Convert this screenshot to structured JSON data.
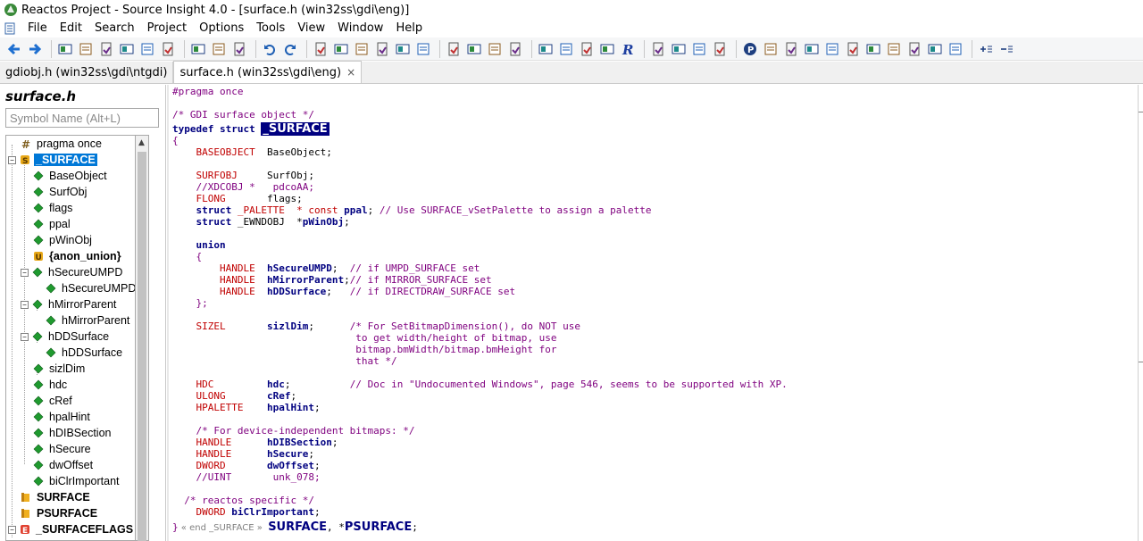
{
  "window": {
    "title": "Reactos Project - Source Insight 4.0 - [surface.h (win32ss\\gdi\\eng)]"
  },
  "menu": {
    "items": [
      "File",
      "Edit",
      "Search",
      "Project",
      "Options",
      "Tools",
      "View",
      "Window",
      "Help"
    ]
  },
  "toolbar": {
    "icons": [
      "back-arrow-icon",
      "forward-arrow-icon",
      "new-file-icon",
      "open-file-icon",
      "save-icon",
      "save-all-icon",
      "close-file-icon",
      "print-icon",
      "cut-icon",
      "copy-icon",
      "paste-icon",
      "undo-icon",
      "redo-icon",
      "search-file-icon",
      "jump-up-icon",
      "jump-down-icon",
      "lookup-icon",
      "replace-icon",
      "browse-icon",
      "bookmark-prev-icon",
      "bookmark-next-icon",
      "goto-line-icon",
      "jump-icon",
      "symbol-info-icon",
      "context-icon",
      "relation-icon",
      "build-icon",
      "rename-icon",
      "window-a-icon",
      "window-b-icon",
      "window-c-icon",
      "window-d-icon",
      "panel-p-icon",
      "panel-grid-icon",
      "panel-tree-icon",
      "panel-s-icon",
      "panel-link-icon",
      "panel-q-icon",
      "panel-split-icon",
      "panel-db-icon",
      "panel-bird-icon",
      "panel-merge-icon",
      "panel-list-icon",
      "zoom-in-icon",
      "zoom-out-icon"
    ]
  },
  "tabs": [
    {
      "label": "gdiobj.h (win32ss\\gdi\\ntgdi)",
      "active": false
    },
    {
      "label": "surface.h (win32ss\\gdi\\eng)",
      "active": true,
      "close": "×"
    }
  ],
  "symbol_panel": {
    "file_title": "surface.h",
    "search_placeholder": "Symbol Name (Alt+L)",
    "items": [
      {
        "label": "pragma once",
        "kind": "pragma",
        "depth": 1,
        "expander": ""
      },
      {
        "label": "_SURFACE",
        "kind": "struct",
        "depth": 0,
        "expander": "−",
        "selected": true
      },
      {
        "label": "BaseObject",
        "kind": "member",
        "depth": 2,
        "expander": ""
      },
      {
        "label": "SurfObj",
        "kind": "member",
        "depth": 2,
        "expander": ""
      },
      {
        "label": "flags",
        "kind": "member",
        "depth": 2,
        "expander": ""
      },
      {
        "label": "ppal",
        "kind": "member",
        "depth": 2,
        "expander": ""
      },
      {
        "label": "pWinObj",
        "kind": "member",
        "depth": 2,
        "expander": ""
      },
      {
        "label": "{anon_union}",
        "kind": "union",
        "depth": 2,
        "expander": "",
        "bold": true
      },
      {
        "label": "hSecureUMPD",
        "kind": "member",
        "depth": 1,
        "expander": "−"
      },
      {
        "label": "hSecureUMPD",
        "kind": "member",
        "depth": 3,
        "expander": ""
      },
      {
        "label": "hMirrorParent",
        "kind": "member",
        "depth": 1,
        "expander": "−"
      },
      {
        "label": "hMirrorParent",
        "kind": "member",
        "depth": 3,
        "expander": ""
      },
      {
        "label": "hDDSurface",
        "kind": "member",
        "depth": 1,
        "expander": "−"
      },
      {
        "label": "hDDSurface",
        "kind": "member",
        "depth": 3,
        "expander": ""
      },
      {
        "label": "sizlDim",
        "kind": "member",
        "depth": 2,
        "expander": ""
      },
      {
        "label": "hdc",
        "kind": "member",
        "depth": 2,
        "expander": ""
      },
      {
        "label": "cRef",
        "kind": "member",
        "depth": 2,
        "expander": ""
      },
      {
        "label": "hpalHint",
        "kind": "member",
        "depth": 2,
        "expander": ""
      },
      {
        "label": "hDIBSection",
        "kind": "member",
        "depth": 2,
        "expander": ""
      },
      {
        "label": "hSecure",
        "kind": "member",
        "depth": 2,
        "expander": ""
      },
      {
        "label": "dwOffset",
        "kind": "member",
        "depth": 2,
        "expander": ""
      },
      {
        "label": "biClrImportant",
        "kind": "member",
        "depth": 2,
        "expander": ""
      },
      {
        "label": "SURFACE",
        "kind": "typedef",
        "depth": 1,
        "expander": "",
        "bold": true
      },
      {
        "label": "PSURFACE",
        "kind": "typedef",
        "depth": 1,
        "expander": "",
        "bold": true
      },
      {
        "label": "_SURFACEFLAGS",
        "kind": "enum",
        "depth": 0,
        "expander": "−",
        "bold": true
      }
    ]
  },
  "editor": {
    "lines": [
      [
        {
          "t": "#pragma once",
          "c": "c-preproc"
        }
      ],
      [],
      [
        {
          "t": "/* GDI surface object */",
          "c": "c-cmt2"
        }
      ],
      [
        {
          "t": "typedef struct ",
          "c": "c-kw"
        },
        {
          "t": "_SURFACE",
          "c": "c-hl"
        }
      ],
      [
        {
          "t": "{",
          "c": "c-brace"
        }
      ],
      [
        {
          "t": "    "
        },
        {
          "t": "BASEOBJECT",
          "c": "c-type"
        },
        {
          "t": "  "
        },
        {
          "t": "BaseObject;"
        }
      ],
      [],
      [
        {
          "t": "    "
        },
        {
          "t": "SURFOBJ",
          "c": "c-type"
        },
        {
          "t": "     "
        },
        {
          "t": "SurfObj;"
        }
      ],
      [
        {
          "t": "    "
        },
        {
          "t": "//XDCOBJ *   pdcoAA;",
          "c": "c-cmt2"
        }
      ],
      [
        {
          "t": "    "
        },
        {
          "t": "FLONG",
          "c": "c-type"
        },
        {
          "t": "       "
        },
        {
          "t": "flags;"
        }
      ],
      [
        {
          "t": "    "
        },
        {
          "t": "struct",
          "c": "c-kw"
        },
        {
          "t": " "
        },
        {
          "t": "_PALETTE  * const ",
          "c": "c-type"
        },
        {
          "t": "ppal",
          "c": "c-member"
        },
        {
          "t": "; "
        },
        {
          "t": "// Use SURFACE_vSetPalette to assign a palette",
          "c": "c-cmt2"
        }
      ],
      [
        {
          "t": "    "
        },
        {
          "t": "struct",
          "c": "c-kw"
        },
        {
          "t": " _EWNDOBJ  *"
        },
        {
          "t": "pWinObj",
          "c": "c-member"
        },
        {
          "t": ";"
        }
      ],
      [],
      [
        {
          "t": "    "
        },
        {
          "t": "union",
          "c": "c-kw"
        }
      ],
      [
        {
          "t": "    "
        },
        {
          "t": "{",
          "c": "c-brace"
        }
      ],
      [
        {
          "t": "        "
        },
        {
          "t": "HANDLE",
          "c": "c-type"
        },
        {
          "t": "  "
        },
        {
          "t": "hSecureUMPD",
          "c": "c-member"
        },
        {
          "t": ";  "
        },
        {
          "t": "// if UMPD_SURFACE set",
          "c": "c-cmt2"
        }
      ],
      [
        {
          "t": "        "
        },
        {
          "t": "HANDLE",
          "c": "c-type"
        },
        {
          "t": "  "
        },
        {
          "t": "hMirrorParent",
          "c": "c-member"
        },
        {
          "t": ";"
        },
        {
          "t": "// if MIRROR_SURFACE set",
          "c": "c-cmt2"
        }
      ],
      [
        {
          "t": "        "
        },
        {
          "t": "HANDLE",
          "c": "c-type"
        },
        {
          "t": "  "
        },
        {
          "t": "hDDSurface",
          "c": "c-member"
        },
        {
          "t": ";   "
        },
        {
          "t": "// if DIRECTDRAW_SURFACE set",
          "c": "c-cmt2"
        }
      ],
      [
        {
          "t": "    "
        },
        {
          "t": "};",
          "c": "c-brace"
        }
      ],
      [],
      [
        {
          "t": "    "
        },
        {
          "t": "SIZEL",
          "c": "c-type"
        },
        {
          "t": "       "
        },
        {
          "t": "sizlDim",
          "c": "c-member"
        },
        {
          "t": ";      "
        },
        {
          "t": "/* For SetBitmapDimension(), do NOT use",
          "c": "c-cmt2"
        }
      ],
      [
        {
          "t": "                               to get width/height of bitmap, use",
          "c": "c-cmt2"
        }
      ],
      [
        {
          "t": "                               bitmap.bmWidth/bitmap.bmHeight for",
          "c": "c-cmt2"
        }
      ],
      [
        {
          "t": "                               that */",
          "c": "c-cmt2"
        }
      ],
      [],
      [
        {
          "t": "    "
        },
        {
          "t": "HDC",
          "c": "c-type"
        },
        {
          "t": "         "
        },
        {
          "t": "hdc",
          "c": "c-member"
        },
        {
          "t": ";          "
        },
        {
          "t": "// Doc in \"Undocumented Windows\", page 546, seems to be supported with XP.",
          "c": "c-cmt2"
        }
      ],
      [
        {
          "t": "    "
        },
        {
          "t": "ULONG",
          "c": "c-type"
        },
        {
          "t": "       "
        },
        {
          "t": "cRef",
          "c": "c-member"
        },
        {
          "t": ";"
        }
      ],
      [
        {
          "t": "    "
        },
        {
          "t": "HPALETTE",
          "c": "c-type"
        },
        {
          "t": "    "
        },
        {
          "t": "hpalHint",
          "c": "c-member"
        },
        {
          "t": ";"
        }
      ],
      [],
      [
        {
          "t": "    "
        },
        {
          "t": "/* For device-independent bitmaps: */",
          "c": "c-cmt2"
        }
      ],
      [
        {
          "t": "    "
        },
        {
          "t": "HANDLE",
          "c": "c-type"
        },
        {
          "t": "      "
        },
        {
          "t": "hDIBSection",
          "c": "c-member"
        },
        {
          "t": ";"
        }
      ],
      [
        {
          "t": "    "
        },
        {
          "t": "HANDLE",
          "c": "c-type"
        },
        {
          "t": "      "
        },
        {
          "t": "hSecure",
          "c": "c-member"
        },
        {
          "t": ";"
        }
      ],
      [
        {
          "t": "    "
        },
        {
          "t": "DWORD",
          "c": "c-type"
        },
        {
          "t": "       "
        },
        {
          "t": "dwOffset",
          "c": "c-member"
        },
        {
          "t": ";"
        }
      ],
      [
        {
          "t": "    "
        },
        {
          "t": "//UINT       unk_078;",
          "c": "c-cmt2"
        }
      ],
      [],
      [
        {
          "t": "  "
        },
        {
          "t": "/* reactos specific */",
          "c": "c-cmt2"
        }
      ],
      [
        {
          "t": "    "
        },
        {
          "t": "DWORD",
          "c": "c-type"
        },
        {
          "t": " "
        },
        {
          "t": "biClrImportant",
          "c": "c-member"
        },
        {
          "t": ";"
        }
      ],
      [
        {
          "t": "}",
          "c": "c-brace"
        },
        {
          "t": " « end _SURFACE »  ",
          "c": "c-endnote"
        },
        {
          "t": "SURFACE",
          "c": "c-big"
        },
        {
          "t": ", *"
        },
        {
          "t": "PSURFACE",
          "c": "c-big"
        },
        {
          "t": ";"
        }
      ]
    ]
  }
}
